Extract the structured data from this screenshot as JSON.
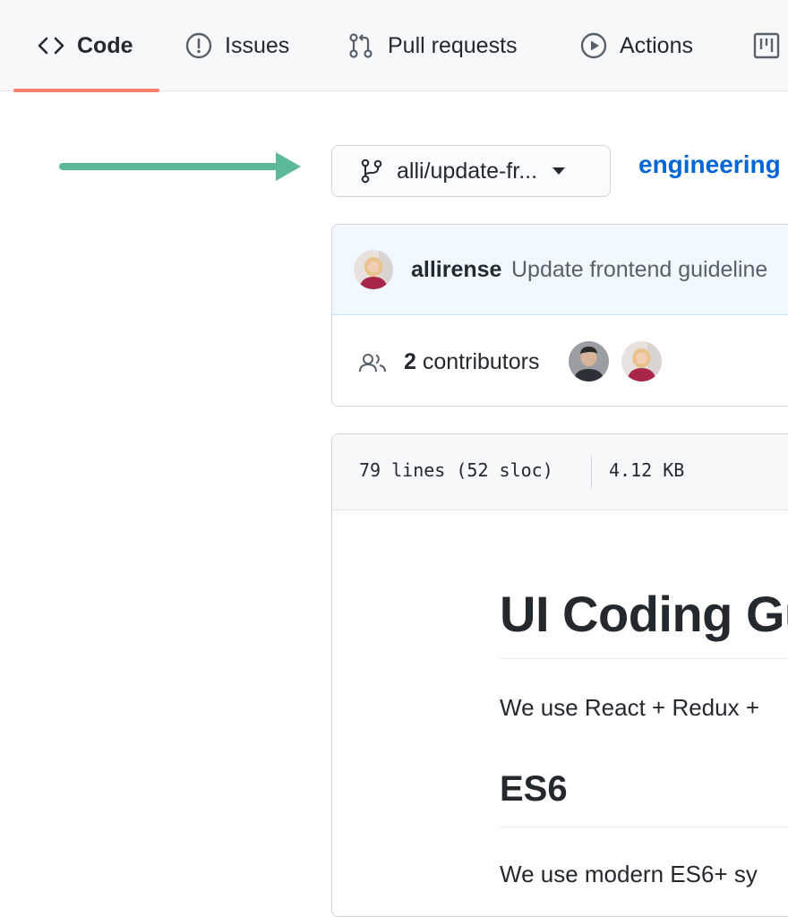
{
  "tabs": [
    {
      "label": "Code",
      "icon": "code-icon",
      "selected": true
    },
    {
      "label": "Issues",
      "icon": "issue-opened-icon"
    },
    {
      "label": "Pull requests",
      "icon": "git-pull-request-icon"
    },
    {
      "label": "Actions",
      "icon": "play-icon"
    },
    {
      "label": "",
      "icon": "project-icon"
    }
  ],
  "branch": {
    "name": "alli/update-fr...",
    "icon": "git-branch-icon"
  },
  "breadcrumb": {
    "repo": "engineering"
  },
  "commit": {
    "author": "allirense",
    "message": "Update frontend guideline"
  },
  "contributors": {
    "count": "2",
    "label": "contributors"
  },
  "file": {
    "lines": "79 lines (52 sloc)",
    "size": "4.12 KB"
  },
  "content": {
    "h1": "UI Coding Gu",
    "p1": "We use React + Redux +",
    "h2": "ES6",
    "p2": "We use modern ES6+ sy"
  },
  "colors": {
    "accent": "#f9826c",
    "link": "#0366d6",
    "annotation_arrow": "#5bb89a"
  }
}
